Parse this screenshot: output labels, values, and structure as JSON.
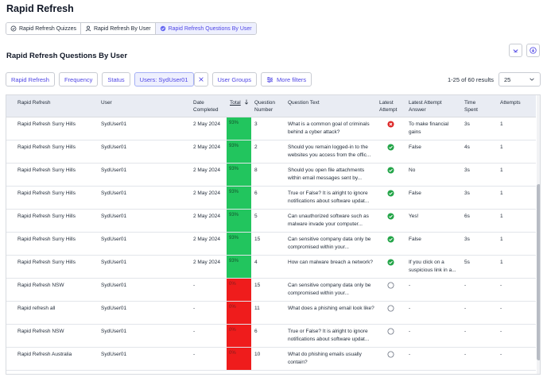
{
  "app": {
    "title": "Rapid Refresh"
  },
  "tabs": [
    {
      "label": "Rapid Refresh Quizzes",
      "icon": "quiz-icon",
      "active": false
    },
    {
      "label": "Rapid Refresh By User",
      "icon": "user-icon",
      "active": false
    },
    {
      "label": "Rapid Refresh Questions By User",
      "icon": "check-circle-icon",
      "active": true
    }
  ],
  "section": {
    "title": "Rapid Refresh Questions By User"
  },
  "filters": {
    "chips": [
      "Rapid Refresh",
      "Frequency",
      "Status"
    ],
    "user_chip": "Users: SydUser01",
    "user_groups": "User Groups",
    "more": "More filters"
  },
  "pagination": {
    "results": "1-25 of 60 results",
    "page_size": "25"
  },
  "columns": {
    "rapid_refresh": "Rapid Refresh",
    "user": "User",
    "date": "Date Completed",
    "total": "Total",
    "qnum": "Question Number",
    "qtext": "Question Text",
    "latest": "Latest Attempt",
    "answer": "Latest Attempt Answer",
    "time": "Time Spent",
    "attempts": "Attempts"
  },
  "rows": [
    {
      "rr": "Rapid Refresh Surry Hills",
      "user": "SydUser01",
      "date": "2 May 2024",
      "total": "93%",
      "correct": true,
      "qnum": "3",
      "qtext": "What is a common goal of criminals behind a cyber attack?",
      "status": "wrong",
      "answer": "To make financial gains",
      "time": "3s",
      "attempts": "1"
    },
    {
      "rr": "Rapid Refresh Surry Hills",
      "user": "SydUser01",
      "date": "2 May 2024",
      "total": "93%",
      "correct": true,
      "qnum": "2",
      "qtext": "Should you remain logged-in to the websites you access from the offic...",
      "status": "correct",
      "answer": "False",
      "time": "4s",
      "attempts": "1"
    },
    {
      "rr": "Rapid Refresh Surry Hills",
      "user": "SydUser01",
      "date": "2 May 2024",
      "total": "93%",
      "correct": true,
      "qnum": "8",
      "qtext": "Should you open file attachments within email messages sent by...",
      "status": "correct",
      "answer": "No",
      "time": "3s",
      "attempts": "1"
    },
    {
      "rr": "Rapid Refresh Surry Hills",
      "user": "SydUser01",
      "date": "2 May 2024",
      "total": "93%",
      "correct": true,
      "qnum": "6",
      "qtext": "True or False? It is alright to ignore notifications about software updat...",
      "status": "correct",
      "answer": "False",
      "time": "3s",
      "attempts": "1"
    },
    {
      "rr": "Rapid Refresh Surry Hills",
      "user": "SydUser01",
      "date": "2 May 2024",
      "total": "93%",
      "correct": true,
      "qnum": "5",
      "qtext": "Can unauthorized software such as malware invade your computer...",
      "status": "correct",
      "answer": "Yes!",
      "time": "6s",
      "attempts": "1"
    },
    {
      "rr": "Rapid Refresh Surry Hills",
      "user": "SydUser01",
      "date": "2 May 2024",
      "total": "93%",
      "correct": true,
      "qnum": "15",
      "qtext": "Can sensitive company data only be compromised within your...",
      "status": "correct",
      "answer": "False",
      "time": "3s",
      "attempts": "1"
    },
    {
      "rr": "Rapid Refresh Surry Hills",
      "user": "SydUser01",
      "date": "2 May 2024",
      "total": "93%",
      "correct": true,
      "qnum": "4",
      "qtext": "How can malware breach a network?",
      "status": "correct",
      "answer": "If you click on a suspicious link in a...",
      "time": "5s",
      "attempts": "1"
    },
    {
      "rr": "Rapid Refresh NSW",
      "user": "SydUser01",
      "date": "-",
      "total": "0%",
      "correct": false,
      "qnum": "15",
      "qtext": "Can sensitive company data only be compromised within your...",
      "status": "none",
      "answer": "-",
      "time": "-",
      "attempts": "-"
    },
    {
      "rr": "Rapid refresh all",
      "user": "SydUser01",
      "date": "-",
      "total": "0%",
      "correct": false,
      "qnum": "11",
      "qtext": "What does a phishing email look like?",
      "status": "none",
      "answer": "-",
      "time": "-",
      "attempts": "-"
    },
    {
      "rr": "Rapid Refresh NSW",
      "user": "SydUser01",
      "date": "-",
      "total": "0%",
      "correct": false,
      "qnum": "6",
      "qtext": "True or False? It is alright to ignore notifications about software updat...",
      "status": "none",
      "answer": "-",
      "time": "-",
      "attempts": "-"
    },
    {
      "rr": "Rapid Refresh Australia",
      "user": "SydUser01",
      "date": "-",
      "total": "0%",
      "correct": false,
      "qnum": "10",
      "qtext": "What do phishing emails usually contain?",
      "status": "none",
      "answer": "-",
      "time": "-",
      "attempts": "-"
    }
  ]
}
